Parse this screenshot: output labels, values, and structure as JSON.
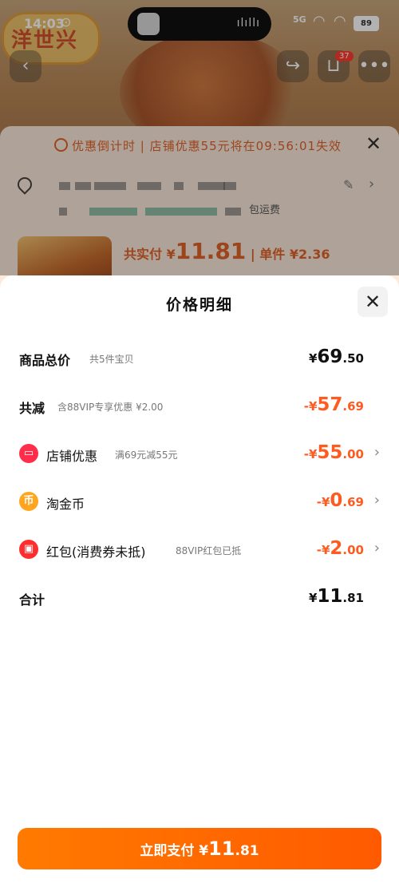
{
  "status_bar": {
    "time": "14:03",
    "signal": "5G",
    "battery": "89"
  },
  "background": {
    "logo_text": "洋世兴",
    "cart_count": "37",
    "countdown": "优惠倒计时 | 店铺优惠55元将在09:56:01失效",
    "address_note": "包运费",
    "total_label": "共实付 ¥",
    "total_value": "11.81",
    "unit_price": "| 单件 ¥2.36"
  },
  "modal": {
    "title": "价格明细",
    "rows": [
      {
        "label": "商品总价",
        "sub": "共5件宝贝",
        "int": "69",
        "dec": ".50",
        "prefix": "¥"
      },
      {
        "label": "共减",
        "sub": "含88VIP专享优惠 ¥2.00",
        "int": "57",
        "dec": ".69",
        "prefix": "-¥"
      },
      {
        "label": "店铺优惠",
        "sub": "满69元减55元",
        "int": "55",
        "dec": ".00",
        "prefix": "-¥",
        "icon": "store-icon",
        "icon_color": "#ff2d4a"
      },
      {
        "label": "淘金币",
        "sub": "",
        "int": "0",
        "dec": ".69",
        "prefix": "-¥",
        "icon": "coin-icon",
        "icon_color": "#ffa51f"
      },
      {
        "label": "红包(消费券未抵)",
        "sub": "88VIP红包已抵",
        "int": "2",
        "dec": ".00",
        "prefix": "-¥",
        "icon": "red-packet-icon",
        "icon_color": "#ff2d2d"
      },
      {
        "label": "合计",
        "sub": "",
        "int": "11",
        "dec": ".81",
        "prefix": "¥"
      }
    ],
    "pay_button": {
      "label": "立即支付",
      "prefix": "¥",
      "int": "11",
      "dec": ".81"
    }
  },
  "colors": {
    "accent": "#ff5a1f",
    "pay_button": "#ff6a00"
  }
}
